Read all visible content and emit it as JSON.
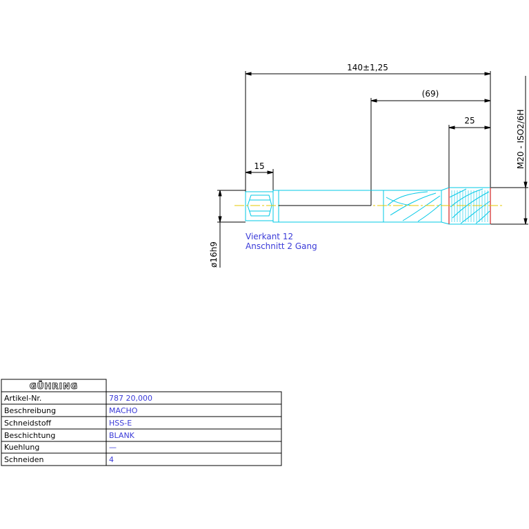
{
  "drawing": {
    "dimensions": {
      "overall_length": "140±1,25",
      "ref_length": "(69)",
      "thread_length": "25",
      "square_length": "15",
      "shank_diameter": "ø16h9",
      "thread_spec": "M20 - ISO2/6H"
    },
    "notes": [
      "Vierkant 12",
      "Anschnitt 2 Gang"
    ]
  },
  "title_block": {
    "logo_text": "GÜHRING",
    "rows": [
      {
        "label": "Artikel-Nr.",
        "value": "787 20,000"
      },
      {
        "label": "Beschreibung",
        "value": "MACHO"
      },
      {
        "label": "Schneidstoff",
        "value": "HSS-E"
      },
      {
        "label": "Beschichtung",
        "value": "BLANK"
      },
      {
        "label": "Kuehlung",
        "value": "—"
      },
      {
        "label": "Schneiden",
        "value": "4"
      }
    ]
  },
  "colors": {
    "tool_outline": "#00c8e6",
    "dimension_line": "#000000",
    "text_blue": "#3a3ad8",
    "center_line": "#e6c800",
    "edge_red": "#d22020"
  }
}
